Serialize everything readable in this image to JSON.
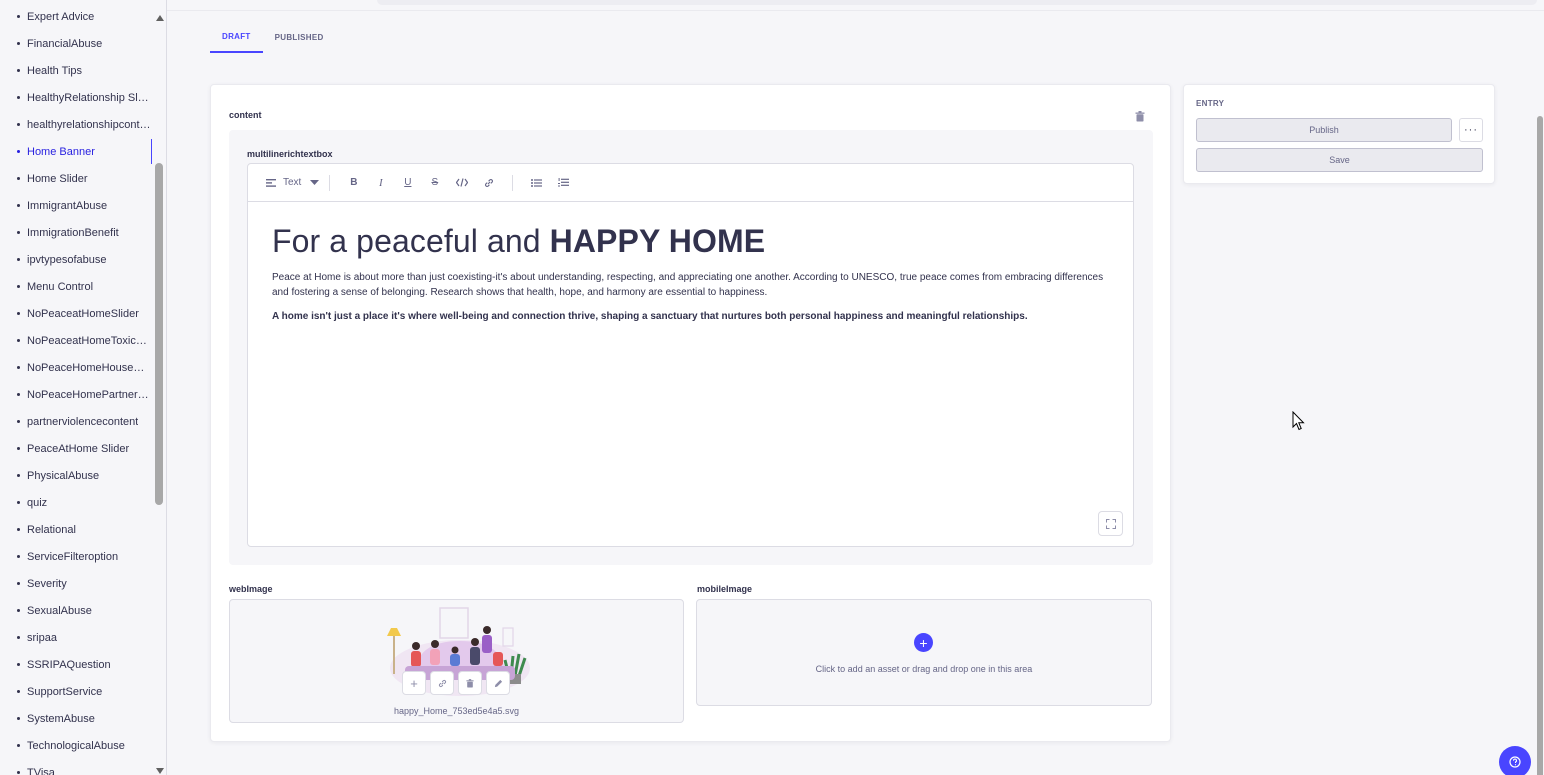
{
  "sidebar": {
    "items": [
      {
        "label": "Expert Advice"
      },
      {
        "label": "FinancialAbuse"
      },
      {
        "label": "Health Tips"
      },
      {
        "label": "HealthyRelationship Slider"
      },
      {
        "label": "healthyrelationshipcontent"
      },
      {
        "label": "Home Banner",
        "active": true
      },
      {
        "label": "Home Slider"
      },
      {
        "label": "ImmigrantAbuse"
      },
      {
        "label": "ImmigrationBenefit"
      },
      {
        "label": "ipvtypesofabuse"
      },
      {
        "label": "Menu Control"
      },
      {
        "label": "NoPeaceatHomeSlider"
      },
      {
        "label": "NoPeaceatHomeToxicRel..."
      },
      {
        "label": "NoPeaceHomeHouseCon..."
      },
      {
        "label": "NoPeaceHomePartnervio..."
      },
      {
        "label": "partnerviolencecontent"
      },
      {
        "label": "PeaceAtHome Slider"
      },
      {
        "label": "PhysicalAbuse"
      },
      {
        "label": "quiz"
      },
      {
        "label": "Relational"
      },
      {
        "label": "ServiceFilteroption"
      },
      {
        "label": "Severity"
      },
      {
        "label": "SexualAbuse"
      },
      {
        "label": "sripaa"
      },
      {
        "label": "SSRIPAQuestion"
      },
      {
        "label": "SupportService"
      },
      {
        "label": "SystemAbuse"
      },
      {
        "label": "TechnologicalAbuse"
      },
      {
        "label": "TVisa"
      }
    ]
  },
  "tabs": [
    {
      "label": "DRAFT",
      "active": true
    },
    {
      "label": "PUBLISHED",
      "active": false
    }
  ],
  "content": {
    "label": "content",
    "field_label": "multilinerichtextbox",
    "toolbar": {
      "text_style": "Text",
      "buttons": [
        "bold-icon",
        "italic-icon",
        "underline-icon",
        "strikethrough-icon",
        "code-icon",
        "link-icon",
        "bullet-list-icon",
        "numbered-list-icon"
      ]
    },
    "heading_regular": "For a peaceful and ",
    "heading_bold": "HAPPY HOME",
    "paragraph": "Peace at Home is about more than just coexisting-it's about understanding, respecting, and appreciating one another. According to UNESCO, true peace comes from embracing differences and fostering a sense of belonging. Research shows that health, hope, and harmony are essential to happiness.",
    "paragraph_bold": "A home isn't just a place it's where well-being and connection thrive, shaping a sanctuary that nurtures both personal happiness and meaningful relationships."
  },
  "web_image": {
    "label": "webImage",
    "filename": "happy_Home_753ed5e4a5.svg"
  },
  "mobile_image": {
    "label": "mobileImage",
    "empty_text": "Click to add an asset or drag and drop one in this area"
  },
  "entry_panel": {
    "title": "ENTRY",
    "publish_label": "Publish",
    "more_label": "···",
    "save_label": "Save"
  },
  "colors": {
    "accent": "#4945ff",
    "text": "#32324d",
    "muted": "#666687"
  }
}
